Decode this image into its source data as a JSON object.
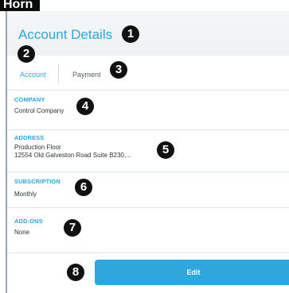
{
  "header": {
    "corner_label": "Horn",
    "title": "Account Details"
  },
  "tabs": [
    {
      "label": "Account",
      "active": true
    },
    {
      "label": "Payment",
      "active": false
    }
  ],
  "sections": {
    "company": {
      "label": "COMPANY",
      "value": "Control Company"
    },
    "address": {
      "label": "ADDRESS",
      "line1": "Production Floor",
      "line2": "12554 Old Galveston Road Suite B230,..."
    },
    "subscription": {
      "label": "SUBSCRIPTION",
      "value": "Monthly"
    },
    "addons": {
      "label": "ADD-ONS",
      "value": "None"
    }
  },
  "actions": {
    "edit_label": "Edit"
  },
  "callouts": [
    "1",
    "2",
    "3",
    "4",
    "5",
    "6",
    "7",
    "8"
  ],
  "colors": {
    "accent": "#2ea7dd",
    "badge": "#111111",
    "text": "#2d3437"
  }
}
